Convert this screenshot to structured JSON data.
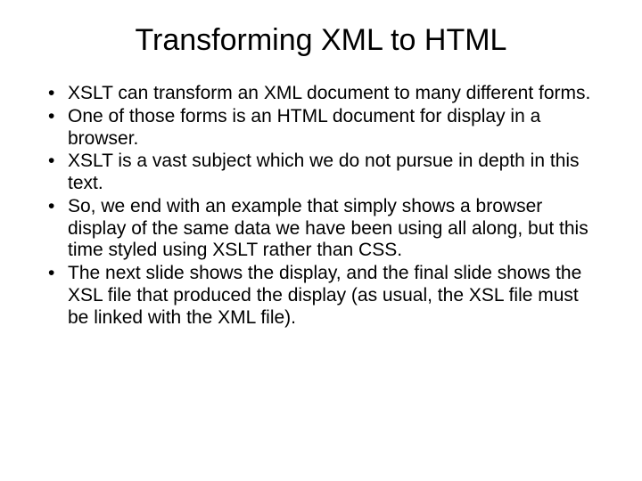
{
  "slide": {
    "title": "Transforming XML to HTML",
    "bullets": [
      "XSLT can transform an XML document to many different forms.",
      "One of those forms is an HTML document for display in a browser.",
      "XSLT is a vast subject which we do not pursue in depth in this text.",
      "So, we end with an example that simply shows a browser display of the same data we have been using all along, but this time styled using XSLT rather than CSS.",
      "The next slide shows the display, and the final slide shows the XSL file that produced the display (as usual, the XSL file must be linked with the XML file)."
    ]
  }
}
